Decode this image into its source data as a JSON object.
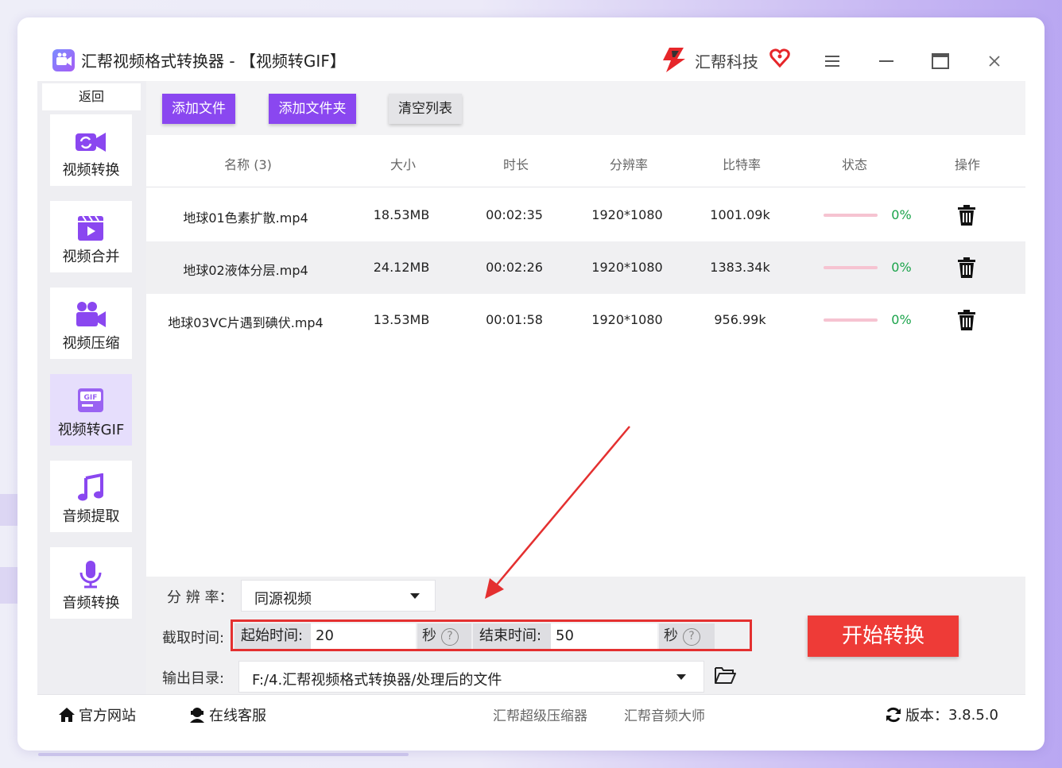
{
  "window": {
    "app_title": "汇帮视频格式转换器  - 【视频转GIF】",
    "brand": "汇帮科技"
  },
  "sidebar": {
    "back_label": "返回",
    "items": [
      {
        "label": "视频转换",
        "icon": "video-convert-icon",
        "active": false
      },
      {
        "label": "视频合并",
        "icon": "video-merge-icon",
        "active": false
      },
      {
        "label": "视频压缩",
        "icon": "video-compress-icon",
        "active": false
      },
      {
        "label": "视频转GIF",
        "icon": "gif-icon",
        "active": true
      },
      {
        "label": "音频提取",
        "icon": "music-note-icon",
        "active": false
      },
      {
        "label": "音频转换",
        "icon": "microphone-icon",
        "active": false
      }
    ]
  },
  "toolbar": {
    "add_file": "添加文件",
    "add_folder": "添加文件夹",
    "clear_list": "清空列表"
  },
  "table": {
    "headers": [
      "名称 (3)",
      "大小",
      "时长",
      "分辨率",
      "比特率",
      "状态",
      "操作"
    ],
    "rows": [
      {
        "name": "地球01色素扩散.mp4",
        "size": "18.53MB",
        "duration": "00:02:35",
        "resolution": "1920*1080",
        "bitrate": "1001.09k",
        "progress": "0%"
      },
      {
        "name": "地球02液体分层.mp4",
        "size": "24.12MB",
        "duration": "00:02:26",
        "resolution": "1920*1080",
        "bitrate": "1383.34k",
        "progress": "0%"
      },
      {
        "name": "地球03VC片遇到碘伏.mp4",
        "size": "13.53MB",
        "duration": "00:01:58",
        "resolution": "1920*1080",
        "bitrate": "956.99k",
        "progress": "0%"
      }
    ]
  },
  "settings": {
    "resolution_label": "分 辨 率：",
    "resolution_value": "同源视频",
    "clip_label": "截取时间:",
    "start_label": "起始时间:",
    "start_value": "20",
    "end_label": "结束时间:",
    "end_value": "50",
    "unit": "秒",
    "help": "?",
    "output_label": "输出目录:",
    "output_path": "F:/4.汇帮视频格式转换器/处理后的文件",
    "start_button": "开始转换"
  },
  "footer": {
    "website": "官方网站",
    "support": "在线客服",
    "link1": "汇帮超级压缩器",
    "link2": "汇帮音频大师",
    "version_label": "版本：",
    "version": "3.8.5.0"
  },
  "colors": {
    "accent": "#8a47f0",
    "start_button": "#ee3b37",
    "highlight_box": "#e43030",
    "annotation_arrow": "#e43030",
    "progress_text": "#1aa34a",
    "progress_bar": "#f6c3d1"
  }
}
